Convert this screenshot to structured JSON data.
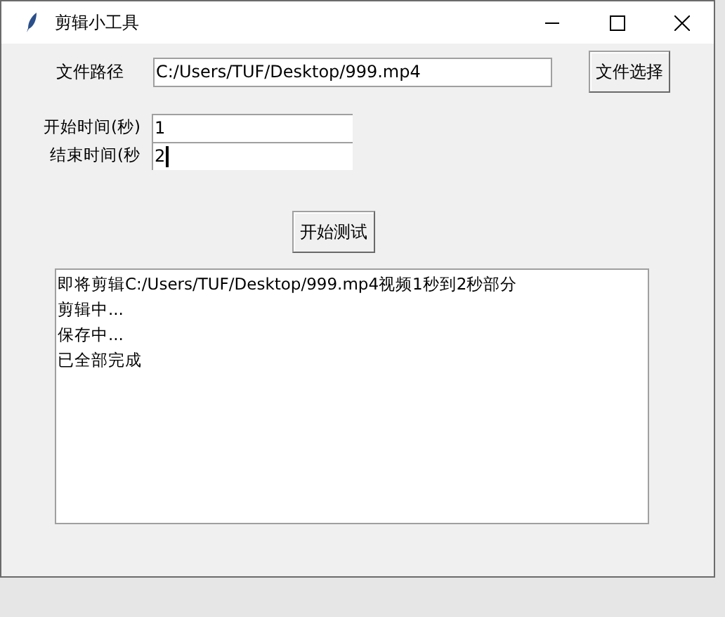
{
  "window": {
    "title": "剪辑小工具"
  },
  "file_path": {
    "label": "文件路径",
    "value": "C:/Users/TUF/Desktop/999.mp4",
    "button": "文件选择"
  },
  "time_fields": [
    {
      "label": "开始时间(秒)",
      "value": "1",
      "focused": false
    },
    {
      "label": "结束时间(秒",
      "value": "2",
      "focused": true
    }
  ],
  "start_button": "开始测试",
  "log": [
    "即将剪辑C:/Users/TUF/Desktop/999.mp4视频1秒到2秒部分",
    "剪辑中...",
    "保存中...",
    "已全部完成"
  ]
}
